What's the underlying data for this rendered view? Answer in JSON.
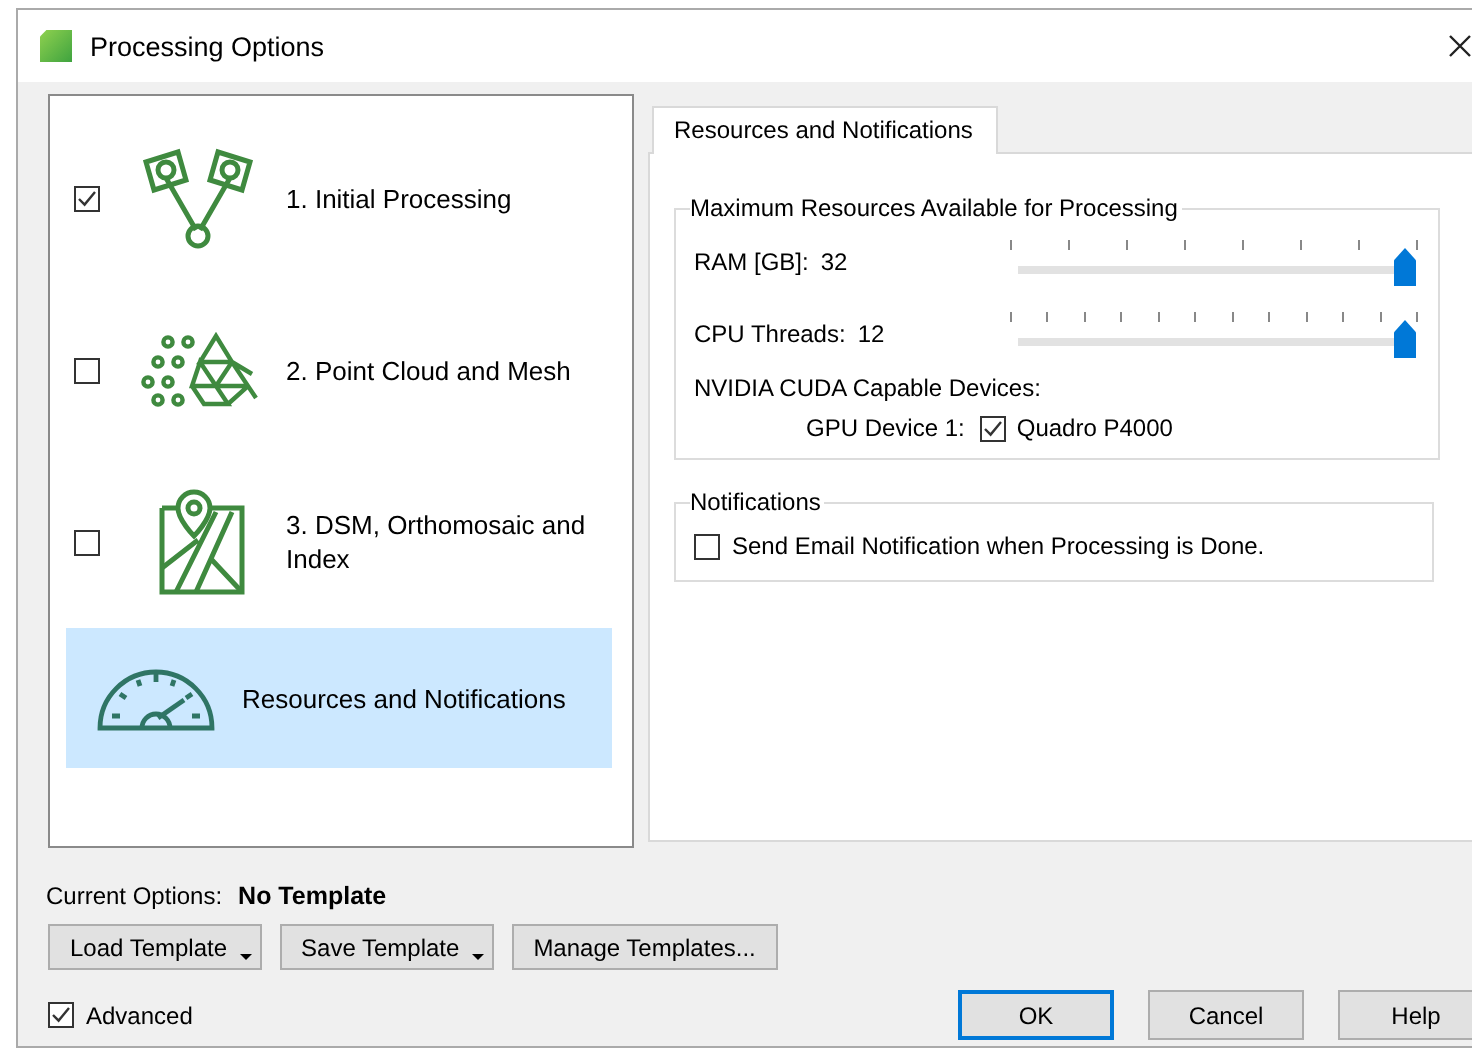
{
  "window": {
    "title": "Processing Options"
  },
  "steps": [
    {
      "kind": "initial",
      "label": "1. Initial Processing",
      "checked": true,
      "selected": false
    },
    {
      "kind": "cloud",
      "label": "2. Point Cloud and Mesh",
      "checked": false,
      "selected": false
    },
    {
      "kind": "map",
      "label": "3. DSM, Orthomosaic and Index",
      "checked": false,
      "selected": false
    },
    {
      "kind": "gauge",
      "label": "Resources and Notifications",
      "selected": true
    }
  ],
  "tabs": [
    {
      "label": "Resources and Notifications",
      "selected": true
    }
  ],
  "resources": {
    "title": "Maximum Resources Available for Processing",
    "sliders": [
      {
        "label": "RAM [GB]:",
        "reading": "32",
        "level": 1
      },
      {
        "label": "CPU Threads:",
        "reading": "12",
        "level": 1
      }
    ],
    "gpu_heading": "NVIDIA CUDA Capable Devices:",
    "gpus": [
      {
        "label": "GPU Device 1:",
        "name": "Quadro P4000",
        "checked": true
      }
    ]
  },
  "notifications": {
    "title": "Notifications",
    "email": {
      "label": "Send Email Notification when Processing is Done.",
      "checked": false
    }
  },
  "current_options": {
    "label": "Current Options:",
    "value": "No Template"
  },
  "template_buttons": [
    {
      "label": "Load Template",
      "dropdown": true
    },
    {
      "label": "Save Template",
      "dropdown": true
    },
    {
      "label": "Manage Templates...",
      "dropdown": false
    }
  ],
  "advanced": {
    "label": "Advanced",
    "checked": true
  },
  "dialog_buttons": [
    {
      "label": "OK",
      "default": true
    },
    {
      "label": "Cancel",
      "default": false
    },
    {
      "label": "Help",
      "default": false
    }
  ]
}
